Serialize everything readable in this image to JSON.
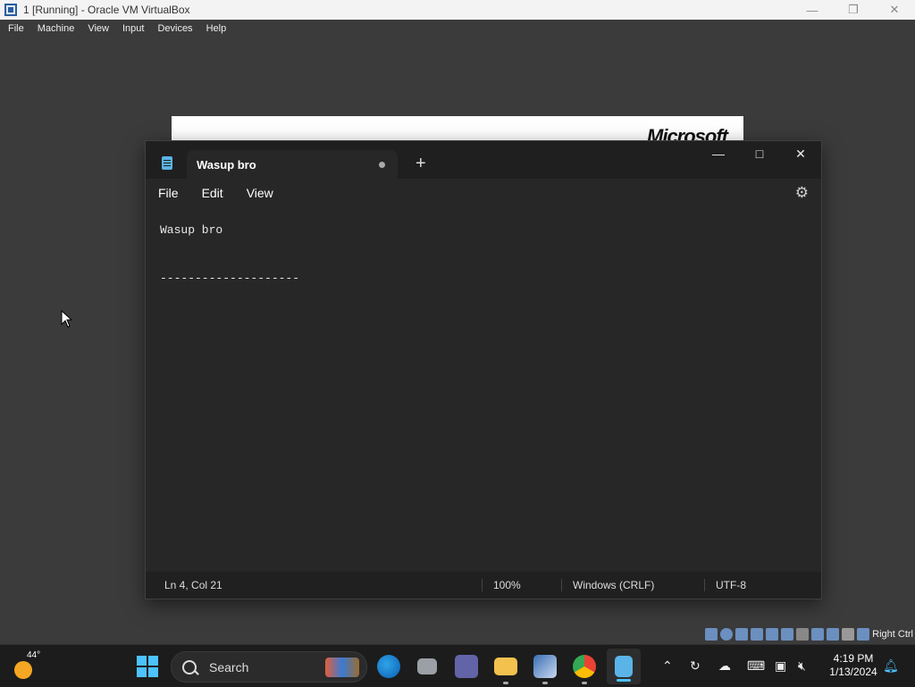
{
  "host": {
    "title": "1 [Running] - Oracle VM VirtualBox",
    "menu": [
      "File",
      "Machine",
      "View",
      "Input",
      "Devices",
      "Help"
    ],
    "host_key": "Right Ctrl"
  },
  "background_window": {
    "logo_text": "Microsoft"
  },
  "notepad": {
    "tab_title": "Wasup bro",
    "tab_modified": true,
    "menu": [
      "File",
      "Edit",
      "View"
    ],
    "content_lines": [
      "Wasup bro",
      "",
      "--------------------"
    ],
    "status": {
      "position": "Ln 4, Col 21",
      "zoom": "100%",
      "line_ending": "Windows (CRLF)",
      "encoding": "UTF-8"
    }
  },
  "taskbar": {
    "weather_temp": "44°",
    "search_label": "Search",
    "pinned_apps": [
      "edge-beta-icon",
      "task-view-icon",
      "teams-icon",
      "file-explorer-icon",
      "windows-2000-icon",
      "chrome-icon",
      "notepad-icon"
    ],
    "time": "4:19 PM",
    "date": "1/13/2024"
  },
  "colors": {
    "accent": "#4cc2ff",
    "notepad_bg": "#272727",
    "desktop_bg": "#3b3b3b"
  }
}
